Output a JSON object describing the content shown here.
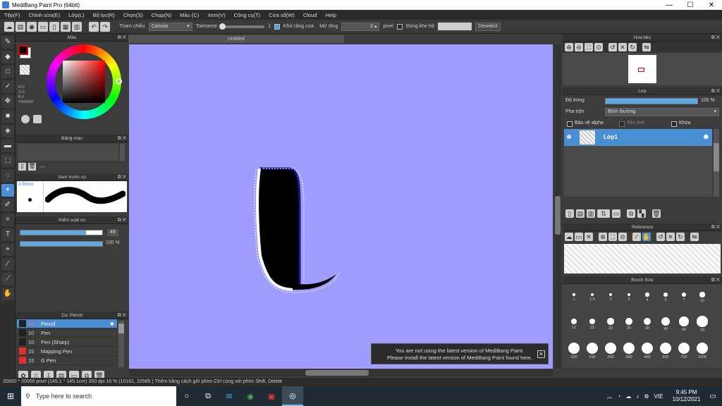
{
  "window": {
    "title": "MediBang Paint Pro (64bit)",
    "min": "—",
    "max": "☐",
    "close": "✕"
  },
  "menu": [
    "Tệp(F)",
    "Chỉnh sửa(E)",
    "Lớp(L)",
    "Bộ lọc(R)",
    "Chọn(S)",
    "Chụp(N)",
    "Màu (C)",
    "Xem(V)",
    "Công cụ(T)",
    "Cửa sổ(W)",
    "Cloud",
    "Help"
  ],
  "toolbar": {
    "reference_label": "Tham chiếu",
    "reference_value": "Canvas",
    "tolerance_label": "Tolerance",
    "tolerance_value": "1",
    "antialias_label": "Khử răng cưa",
    "expand_label": "Mở rộng",
    "expand_value": "0",
    "expand_unit": "pixel",
    "close_gap_label": "Đóng khe hở",
    "deselect_label": "Deselect"
  },
  "color_panel": {
    "title": "Màu",
    "r": "R:0",
    "g": "G:0",
    "b": "B:0",
    "hex": "#000000",
    "current_color": "#000000"
  },
  "palette_panel": {
    "title": "Bảng màu",
    "dash": "---"
  },
  "brush_preview": {
    "title": "Xem trước cọ",
    "size": "3.50mm"
  },
  "brush_control": {
    "title": "Kiểm soát cọ",
    "size_value": "49",
    "opacity_value": "100 %",
    "size_fraction": 0.8,
    "opacity_fraction": 1.0
  },
  "brush_list": {
    "title": "Cọ: Pencil",
    "items": [
      {
        "num": "49",
        "name": "Pencil",
        "color": "#222222",
        "active": true
      },
      {
        "num": "10",
        "name": "Pen",
        "color": "#222222"
      },
      {
        "num": "10",
        "name": "Pen (Sharp)",
        "color": "#222222"
      },
      {
        "num": "15",
        "name": "Mapping Pen",
        "color": "#e03030"
      },
      {
        "num": "15",
        "name": "G Pen",
        "color": "#e03030"
      }
    ]
  },
  "canvas": {
    "tab": "Untitled",
    "bg": "#9e9dfe"
  },
  "notification": {
    "line1": "You are not using the latest version of MediBang Paint.",
    "line2": "Please install the latest version of MediBang Paint found here.",
    "close": "✕"
  },
  "navigator": {
    "title": "Hoa tiêu"
  },
  "layer_panel": {
    "title": "Lớp",
    "opacity_label": "Độ trong",
    "opacity_value": "100 %",
    "blend_label": "Pha trộn",
    "blend_value": "Bình thường",
    "protect_alpha": "Bảo vệ alpha",
    "clipping": "Xén bớt",
    "lock": "Khóa",
    "layer_name": "Lớp1"
  },
  "reference_panel": {
    "title": "Reference"
  },
  "brush_size_panel": {
    "title": "Brush Size",
    "sizes": [
      "1",
      "1.5",
      "2",
      "3",
      "4",
      "5",
      "7",
      "10",
      "12",
      "15",
      "20",
      "25",
      "30",
      "40",
      "50",
      "70",
      "100",
      "150",
      "200",
      "300",
      "400",
      "500",
      "700",
      "1000"
    ]
  },
  "status": {
    "text": "20000 * 20000 pixel  (145.1 * 145.1cm)  350 dpi  16 %  (10161, 10585 )  Thêm bằng cách giữ phím Ctrl cùng với phím Shift, Delete"
  },
  "taskbar": {
    "search_placeholder": "Type here to search",
    "lang": "VIE",
    "time": "9:45 PM",
    "date": "10/12/2021"
  }
}
